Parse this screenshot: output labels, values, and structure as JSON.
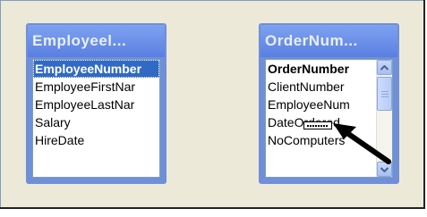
{
  "tables": [
    {
      "title": "Employeel...",
      "fields": [
        "EmployeeNumber",
        "EmployeeFirstNar",
        "EmployeeLastNar",
        "Salary",
        "HireDate"
      ]
    },
    {
      "title": "OrderNum...",
      "fields": [
        "OrderNumber",
        "ClientNumber",
        "EmployeeNum",
        "DateOrdered",
        "NoComputers"
      ]
    }
  ],
  "colors": {
    "selection": "#316ac5",
    "title_bar": "#5a7fe2",
    "background": "#ece9d8"
  },
  "icons": [
    "scroll-up-icon",
    "scroll-down-icon",
    "drag-field-icon",
    "arrow-pointer-icon"
  ]
}
